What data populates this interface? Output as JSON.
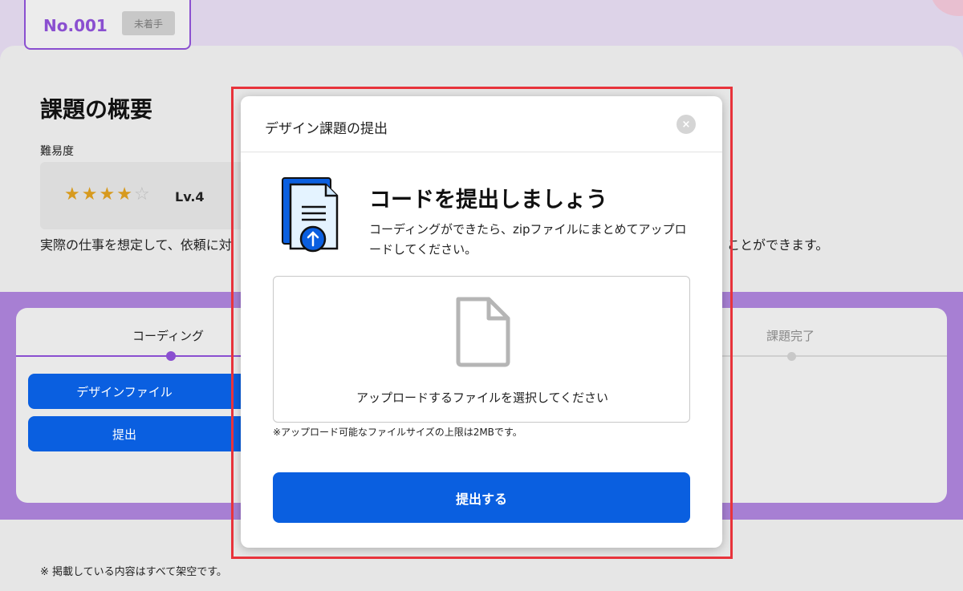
{
  "tab": {
    "number": "No.001",
    "status": "未着手"
  },
  "overview": {
    "title": "課題の概要",
    "difficulty_label": "難易度",
    "rating": 4,
    "rating_max": 5,
    "level": "Lv.4",
    "description_left": "実際の仕事を想定して、依頼に対",
    "description_right": "ことができます。"
  },
  "steps": {
    "current_label": "コーディング",
    "last_label": "課題完了",
    "buttons": {
      "design_file": "デザインファイル",
      "submit": "提出"
    }
  },
  "footnote": "※ 掲載している内容はすべて架空です。",
  "modal": {
    "title": "デザイン課題の提出",
    "close_label": "×",
    "hero_title": "コードを提出しましょう",
    "hero_text": "コーディングができたら、zipファイルにまとめてアップロードしてください。",
    "dropzone_text": "アップロードするファイルを選択してください",
    "limit_note": "※アップロード可能なファイルサイズの上限は2MBです。",
    "submit_label": "提出する"
  },
  "colors": {
    "accent_purple": "#8a4fd0",
    "primary_blue": "#0a5fe0",
    "highlight_red": "#e8333b",
    "star_gold": "#d79a1e"
  }
}
